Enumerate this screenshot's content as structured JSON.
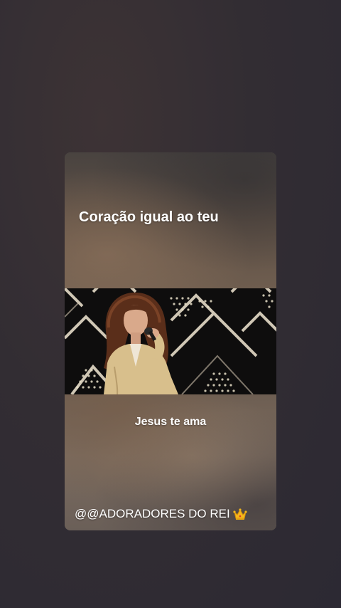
{
  "story": {
    "headline": "Coração igual ao teu",
    "caption": "Jesus te ama",
    "handle": "@@ADORADORES DO REI",
    "handle_icon": "crown-icon"
  },
  "colors": {
    "background": "#322d33",
    "text": "#ffffff",
    "jacket": "#d8bf8c",
    "stage_lines": "#e6dcc8"
  }
}
